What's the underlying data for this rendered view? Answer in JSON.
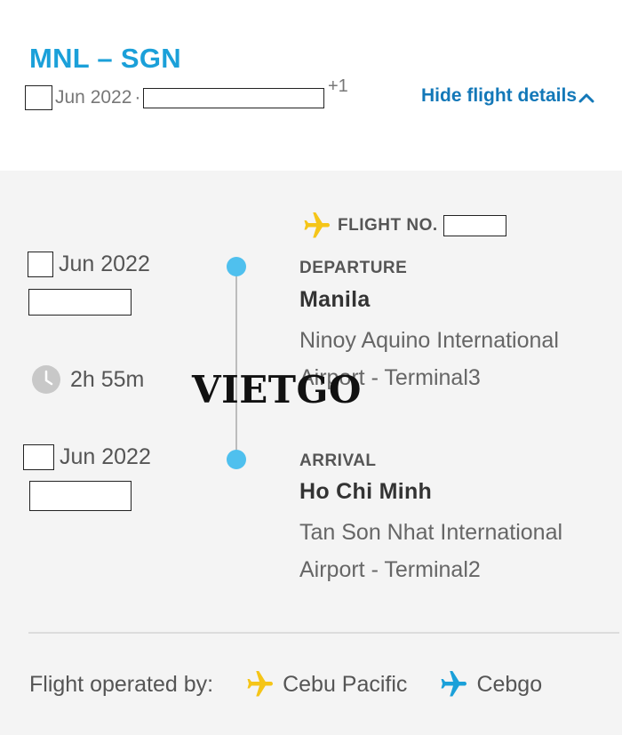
{
  "header": {
    "route": "MNL – SGN",
    "month_year": "Jun 2022",
    "separator": "·",
    "day_offset": "+1",
    "hide_details_label": "Hide flight details"
  },
  "flight": {
    "flight_no_label": "FLIGHT NO.",
    "departure": {
      "date": "Jun 2022",
      "label": "DEPARTURE",
      "city": "Manila",
      "airport": "Ninoy Aquino International Airport - Terminal3"
    },
    "duration": "2h 55m",
    "arrival": {
      "date": "Jun 2022",
      "label": "ARRIVAL",
      "city": "Ho Chi Minh",
      "airport": "Tan Son Nhat International Airport - Terminal2"
    }
  },
  "watermark": "VIETGO",
  "footer": {
    "operated_by_label": "Flight operated by:",
    "airlines": [
      {
        "name": "Cebu Pacific",
        "icon": "plane-icon",
        "color": "#f5c518"
      },
      {
        "name": "Cebgo",
        "icon": "plane-icon",
        "color": "#1ba0d9"
      }
    ]
  },
  "colors": {
    "route": "#1ba0d9",
    "link": "#1378b8",
    "timeline_dot": "#4fc0ee",
    "plane_yellow": "#f5c518",
    "plane_blue": "#1ba0d9"
  }
}
